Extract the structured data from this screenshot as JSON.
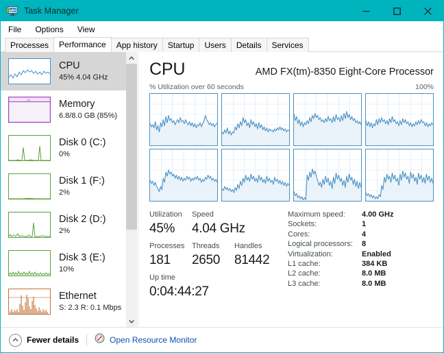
{
  "window": {
    "title": "Task Manager",
    "icon": "task-manager-icon",
    "accent_color": "#00b4bd",
    "controls": {
      "minimize": "minimize-icon",
      "maximize": "maximize-icon",
      "close": "close-icon"
    }
  },
  "menu": [
    "File",
    "Options",
    "View"
  ],
  "tabs": [
    {
      "label": "Processes",
      "active": false
    },
    {
      "label": "Performance",
      "active": true
    },
    {
      "label": "App history",
      "active": false
    },
    {
      "label": "Startup",
      "active": false
    },
    {
      "label": "Users",
      "active": false
    },
    {
      "label": "Details",
      "active": false
    },
    {
      "label": "Services",
      "active": false
    }
  ],
  "sidebar": {
    "items": [
      {
        "name": "CPU",
        "sub": "45%  4.04 GHz",
        "color": "#3f8fcc",
        "fill": "#e8f2fa",
        "selected": true,
        "kind": "line"
      },
      {
        "name": "Memory",
        "sub": "6.8/8.0 GB (85%)",
        "color": "#a03fc6",
        "fill": "#f4eef7",
        "selected": false,
        "kind": "memory"
      },
      {
        "name": "Disk 0 (C:)",
        "sub": "0%",
        "color": "#57a13b",
        "fill": "#ffffff",
        "selected": false,
        "kind": "spike"
      },
      {
        "name": "Disk 1 (F:)",
        "sub": "2%",
        "color": "#57a13b",
        "fill": "#ffffff",
        "selected": false,
        "kind": "flat"
      },
      {
        "name": "Disk 2 (D:)",
        "sub": "2%",
        "color": "#57a13b",
        "fill": "#ffffff",
        "selected": false,
        "kind": "spike2"
      },
      {
        "name": "Disk 3 (E:)",
        "sub": "10%",
        "color": "#57a13b",
        "fill": "#ffffff",
        "selected": false,
        "kind": "low"
      },
      {
        "name": "Ethernet",
        "sub": "S: 2.3 R: 0.1 Mbps",
        "color": "#c2703a",
        "fill": "#ffffff",
        "selected": false,
        "kind": "net"
      }
    ],
    "scroll": {
      "up": "chevron-up-icon",
      "down": "chevron-down-icon"
    }
  },
  "main": {
    "title": "CPU",
    "model": "AMD FX(tm)-8350 Eight-Core Processor",
    "graph_caption": "% Utilization over 60 seconds",
    "graph_max": "100%",
    "stats": {
      "utilization_label": "Utilization",
      "utilization_value": "45%",
      "speed_label": "Speed",
      "speed_value": "4.04 GHz",
      "processes_label": "Processes",
      "processes_value": "181",
      "threads_label": "Threads",
      "threads_value": "2650",
      "handles_label": "Handles",
      "handles_value": "81442",
      "uptime_label": "Up time",
      "uptime_value": "0:04:44:27"
    },
    "specs": [
      {
        "key": "Maximum speed:",
        "value": "4.00 GHz"
      },
      {
        "key": "Sockets:",
        "value": "1"
      },
      {
        "key": "Cores:",
        "value": "4"
      },
      {
        "key": "Logical processors:",
        "value": "8"
      },
      {
        "key": "Virtualization:",
        "value": "Enabled"
      },
      {
        "key": "L1 cache:",
        "value": "384 KB"
      },
      {
        "key": "L2 cache:",
        "value": "8.0 MB"
      },
      {
        "key": "L3 cache:",
        "value": "8.0 MB"
      }
    ]
  },
  "chart_data": {
    "type": "line",
    "title": "% Utilization over 60 seconds",
    "ylim": [
      0,
      100
    ],
    "xlabel": "60 seconds",
    "ylabel": "% Utilization",
    "grid": true,
    "legend": "none",
    "line_color": "#4a90c4",
    "fill_color": "#eaf3fa",
    "series": [
      {
        "name": "CPU 0",
        "values": [
          42,
          36,
          40,
          34,
          46,
          30,
          38,
          26,
          44,
          36,
          50,
          38,
          56,
          44,
          58,
          48,
          52,
          44,
          48,
          40,
          46,
          50,
          44,
          54,
          46,
          48,
          42,
          50,
          44,
          40,
          46,
          38,
          44,
          36,
          42,
          34,
          40,
          38,
          44,
          36,
          42,
          48,
          58,
          50,
          46,
          40,
          44,
          38,
          42,
          36,
          40,
          44
        ]
      },
      {
        "name": "CPU 1",
        "values": [
          26,
          22,
          30,
          24,
          34,
          22,
          28,
          20,
          26,
          24,
          36,
          30,
          42,
          34,
          46,
          38,
          54,
          44,
          50,
          38,
          44,
          34,
          50,
          40,
          46,
          36,
          42,
          32,
          44,
          34,
          40,
          30,
          36,
          28,
          34,
          26,
          32,
          28,
          30,
          26,
          32,
          28,
          34,
          30,
          36,
          30,
          34,
          28,
          32,
          26,
          30,
          28
        ]
      },
      {
        "name": "CPU 2",
        "values": [
          62,
          48,
          56,
          42,
          50,
          38,
          46,
          36,
          44,
          40,
          48,
          42,
          54,
          46,
          58,
          52,
          62,
          54,
          58,
          50,
          54,
          46,
          50,
          44,
          52,
          46,
          56,
          48,
          52,
          44,
          56,
          46,
          60,
          50,
          54,
          46,
          58,
          48,
          62,
          52,
          66,
          54,
          60,
          50,
          56,
          48,
          52,
          44,
          48,
          42,
          46,
          40
        ]
      },
      {
        "name": "CPU 3",
        "values": [
          48,
          38,
          46,
          36,
          44,
          34,
          42,
          38,
          50,
          40,
          52,
          44,
          54,
          46,
          50,
          42,
          48,
          40,
          52,
          44,
          56,
          46,
          50,
          42,
          46,
          38,
          48,
          40,
          52,
          44,
          50,
          42,
          46,
          38,
          44,
          36,
          42,
          38,
          46,
          40,
          48,
          42,
          50,
          44,
          46,
          38,
          44,
          36,
          42,
          38,
          44,
          40
        ]
      },
      {
        "name": "CPU 4",
        "values": [
          40,
          34,
          38,
          30,
          36,
          28,
          24,
          18,
          28,
          22,
          44,
          36,
          56,
          48,
          60,
          52,
          56,
          48,
          52,
          44,
          50,
          42,
          48,
          40,
          46,
          38,
          44,
          40,
          48,
          42,
          46,
          38,
          44,
          40,
          46,
          42,
          48,
          40,
          44,
          36,
          42,
          38,
          46,
          42,
          50,
          44,
          48,
          40,
          44,
          38,
          42,
          36
        ]
      },
      {
        "name": "CPU 5",
        "values": [
          24,
          20,
          28,
          22,
          26,
          20,
          24,
          18,
          22,
          16,
          26,
          20,
          32,
          24,
          38,
          30,
          44,
          36,
          50,
          40,
          46,
          38,
          52,
          42,
          48,
          38,
          44,
          36,
          50,
          40,
          46,
          36,
          42,
          34,
          48,
          38,
          44,
          36,
          40,
          32,
          46,
          38,
          42,
          34,
          40,
          32,
          38,
          30,
          36,
          28,
          34,
          30
        ]
      },
      {
        "name": "CPU 6",
        "values": [
          18,
          10,
          14,
          6,
          10,
          4,
          8,
          2,
          6,
          2,
          50,
          40,
          56,
          46,
          62,
          52,
          58,
          48,
          40,
          30,
          36,
          26,
          42,
          32,
          48,
          36,
          44,
          30,
          38,
          24,
          46,
          34,
          54,
          42,
          50,
          38,
          44,
          30,
          40,
          26,
          48,
          36,
          52,
          40,
          46,
          32,
          42,
          28,
          38,
          24,
          36,
          26
        ]
      },
      {
        "name": "CPU 7",
        "values": [
          16,
          10,
          14,
          8,
          12,
          6,
          10,
          4,
          8,
          4,
          12,
          8,
          30,
          22,
          46,
          36,
          52,
          42,
          48,
          36,
          54,
          42,
          50,
          38,
          44,
          30,
          52,
          40,
          58,
          46,
          54,
          42,
          48,
          34,
          56,
          44,
          52,
          38,
          46,
          32,
          54,
          42,
          50,
          36,
          46,
          34,
          52,
          40,
          48,
          36,
          44,
          34
        ]
      }
    ]
  },
  "footer": {
    "fewer_details": "Fewer details",
    "fewer_icon": "chevron-up-circle-icon",
    "resource_monitor": "Open Resource Monitor",
    "resource_monitor_icon": "resource-monitor-icon",
    "link_color": "#0c4fb0"
  }
}
